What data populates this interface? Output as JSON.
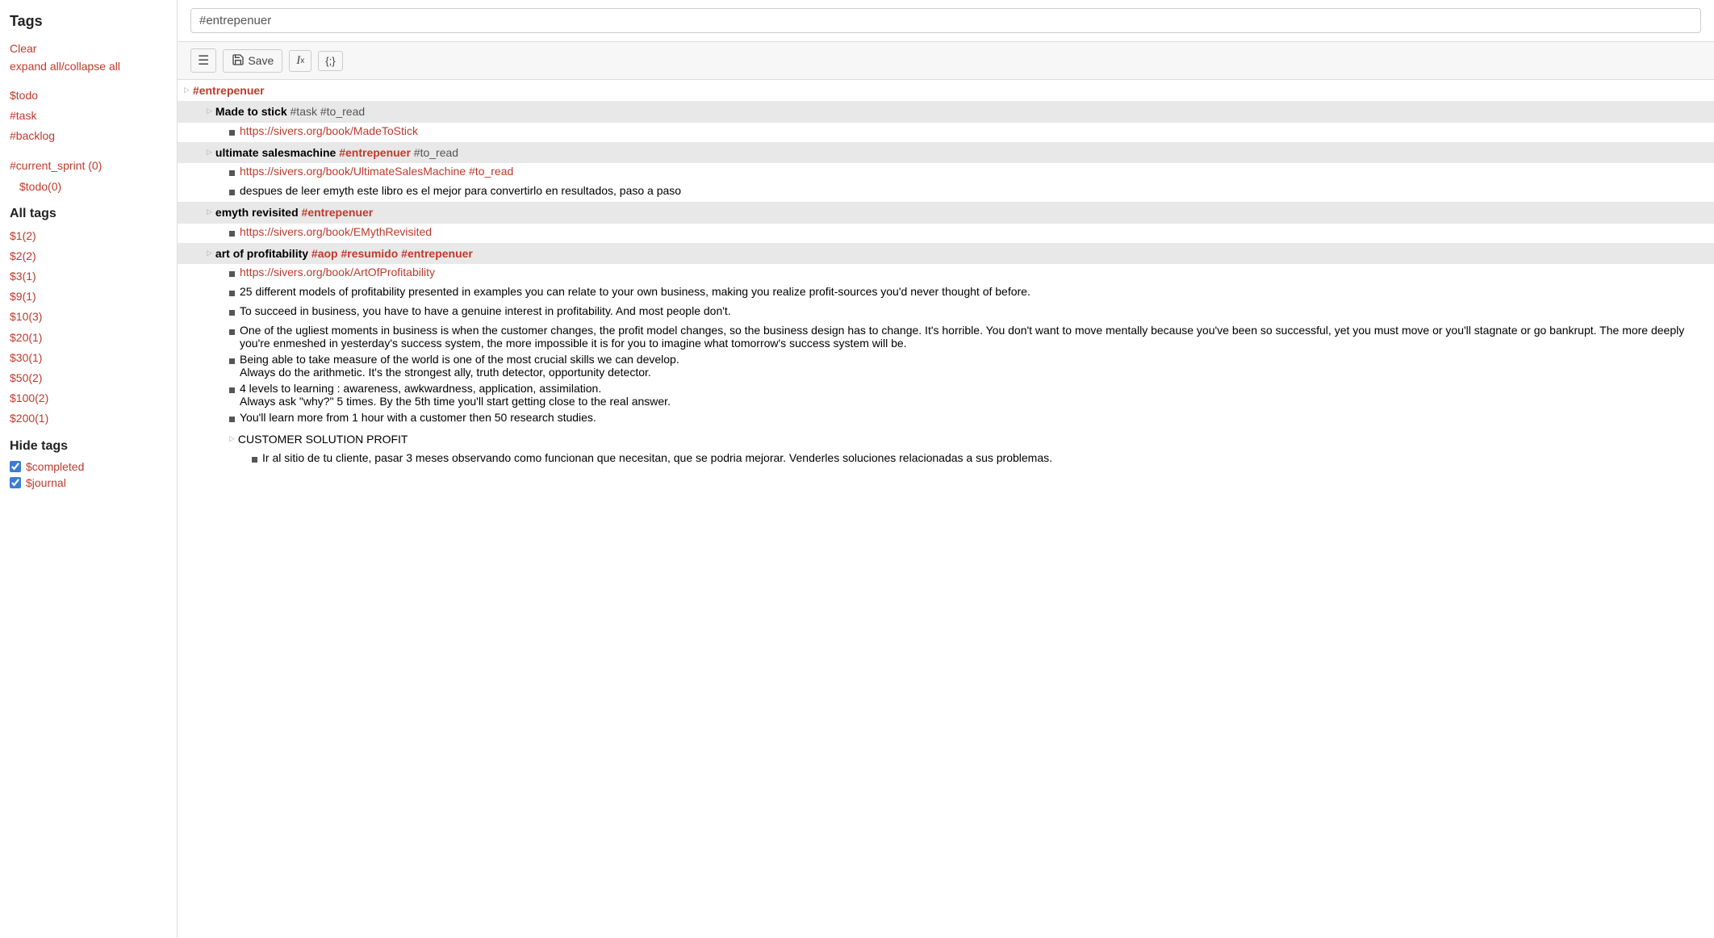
{
  "sidebar": {
    "title": "Tags",
    "clear_label": "Clear",
    "expand_all_label": "expand all",
    "collapse_all_label": "collapse all",
    "active_tags": [
      "$todo",
      "#task",
      "#backlog"
    ],
    "sprint_section": {
      "tag": "#current_sprint (0)",
      "sub": "$todo(0)"
    },
    "all_tags_label": "All tags",
    "tag_list": [
      "$1(2)",
      "$2(2)",
      "$3(1)",
      "$9(1)",
      "$10(3)",
      "$20(1)",
      "$30(1)",
      "$50(2)",
      "$100(2)",
      "$200(1)"
    ],
    "hide_tags_label": "Hide tags",
    "checkboxes": [
      {
        "id": "cb1",
        "label": "$completed",
        "checked": true
      },
      {
        "id": "cb2",
        "label": "$journal",
        "checked": true
      }
    ]
  },
  "search": {
    "value": "#entrepenuer",
    "placeholder": "#entrepenuer"
  },
  "toolbar": {
    "list_icon": "☰",
    "save_label": "Save",
    "format_icon": "𝐼x",
    "code_icon": "{;}",
    "save_icon": "💾"
  },
  "outline": {
    "root_tag": "#entrepenuer",
    "items": [
      {
        "id": "n1",
        "indent": 1,
        "type": "header",
        "highlighted": true,
        "parts": [
          {
            "text": "Made to stick ",
            "style": "bold-gray"
          },
          {
            "text": "#task #to_read",
            "style": "normal-gray"
          }
        ]
      },
      {
        "id": "n2",
        "indent": 2,
        "type": "bullet",
        "parts": [
          {
            "text": "https://sivers.org/book/MadeToStick",
            "style": "link"
          }
        ]
      },
      {
        "id": "n3",
        "indent": 1,
        "type": "header",
        "highlighted": true,
        "parts": [
          {
            "text": "ultimate salesmachine ",
            "style": "bold-gray"
          },
          {
            "text": "#entrepenuer",
            "style": "tag"
          },
          {
            "text": " #to_read",
            "style": "normal-gray"
          }
        ]
      },
      {
        "id": "n4",
        "indent": 2,
        "type": "bullet",
        "parts": [
          {
            "text": "https://sivers.org/book/UltimateSalesMachine #to_read",
            "style": "link"
          }
        ]
      },
      {
        "id": "n5",
        "indent": 2,
        "type": "bullet",
        "parts": [
          {
            "text": "despues de leer emyth este libro es el mejor para convertirlo en resultados, paso a paso",
            "style": "normal"
          }
        ]
      },
      {
        "id": "n6",
        "indent": 1,
        "type": "header",
        "highlighted": true,
        "parts": [
          {
            "text": "emyth revisited ",
            "style": "bold-gray"
          },
          {
            "text": "#entrepenuer",
            "style": "tag"
          }
        ]
      },
      {
        "id": "n7",
        "indent": 2,
        "type": "bullet",
        "parts": [
          {
            "text": "https://sivers.org/book/EMythRevisited",
            "style": "link"
          }
        ]
      },
      {
        "id": "n8",
        "indent": 1,
        "type": "header",
        "highlighted": true,
        "parts": [
          {
            "text": "art of profitability ",
            "style": "bold-gray"
          },
          {
            "text": "#aop #resumido #entrepenuer",
            "style": "tag"
          }
        ]
      },
      {
        "id": "n9",
        "indent": 2,
        "type": "bullet",
        "parts": [
          {
            "text": "https://sivers.org/book/ArtOfProfitability",
            "style": "link"
          }
        ]
      },
      {
        "id": "n10",
        "indent": 2,
        "type": "bullet",
        "parts": [
          {
            "text": "25 different models of profitability presented in examples you can relate to your own business, making you realize profit-sources you'd never thought of before.",
            "style": "normal"
          }
        ]
      },
      {
        "id": "n11",
        "indent": 2,
        "type": "bullet",
        "parts": [
          {
            "text": "To succeed in business, you have to have a genuine interest in profitability. And most people don't.",
            "style": "normal"
          }
        ]
      },
      {
        "id": "n12",
        "indent": 2,
        "type": "bullet",
        "parts": [
          {
            "text": "One of the ugliest moments in business is when the customer changes, the profit model changes, so the business design has to change. It's horrible. You don't want to move mentally because you've been so successful, yet you must move or you'll stagnate or go bankrupt. The more deeply you're enmeshed in yesterday's success system, the more impossible it is for you to imagine what tomorrow's success system will be.",
            "style": "normal"
          }
        ]
      },
      {
        "id": "n13",
        "indent": 2,
        "type": "bullet",
        "parts": [
          {
            "text": "Being able to take measure of the world is one of the most crucial skills we can develop.\nAlways do the arithmetic. It's the strongest ally, truth detector, opportunity detector.",
            "style": "normal"
          }
        ]
      },
      {
        "id": "n14",
        "indent": 2,
        "type": "bullet",
        "parts": [
          {
            "text": "4 levels to learning : awareness, awkwardness, application, assimilation.\nAlways ask \"why?\" 5 times. By the 5th time you'll start getting close to the real answer.",
            "style": "normal"
          }
        ]
      },
      {
        "id": "n15",
        "indent": 2,
        "type": "bullet",
        "parts": [
          {
            "text": "You'll learn more from 1 hour with a customer then 50 research studies.",
            "style": "normal"
          }
        ]
      },
      {
        "id": "n16",
        "indent": 2,
        "type": "header",
        "highlighted": false,
        "parts": [
          {
            "text": "CUSTOMER SOLUTION PROFIT",
            "style": "normal-bold"
          }
        ]
      },
      {
        "id": "n17",
        "indent": 3,
        "type": "bullet",
        "parts": [
          {
            "text": "Ir al sitio de tu cliente, pasar 3 meses observando como funcionan que necesitan, que se podria mejorar. Venderles soluciones relacionadas a sus problemas.",
            "style": "normal"
          }
        ]
      }
    ]
  }
}
